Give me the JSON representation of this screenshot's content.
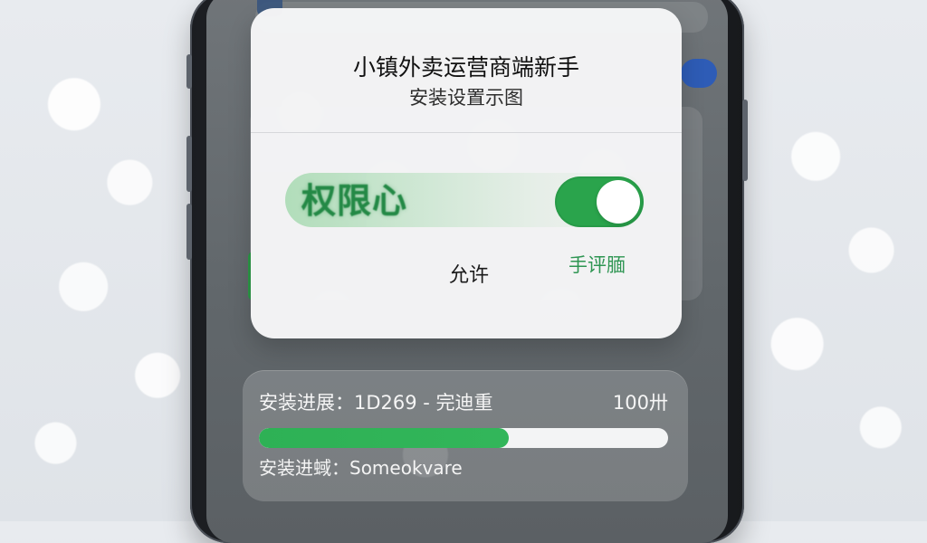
{
  "dialog": {
    "title": "小镇外卖运营商端新手",
    "subtitle": "安装设置示图",
    "permission_label": "权限心",
    "toggle_state": "on",
    "allow_text": "允许",
    "secondary_text": "手评腼"
  },
  "progress_card": {
    "title": "安装进展：1D269 - 完迪重",
    "percent_text": "100卅",
    "progress_value": 0.61,
    "subtitle": "安装进蜮：Someokvare"
  },
  "colors": {
    "accent_green": "#2aa44c",
    "text_green": "#2e9552",
    "dialog_bg": "#f5f5f6"
  },
  "icons": {
    "toggle": "switch-toggle"
  }
}
